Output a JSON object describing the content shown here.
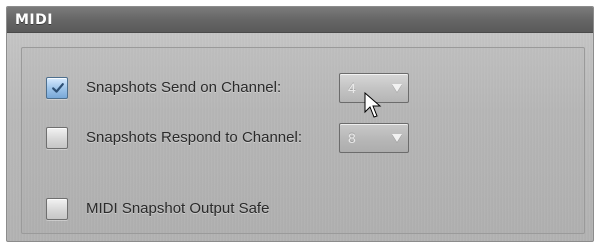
{
  "panel": {
    "title": "MIDI"
  },
  "rows": [
    {
      "checkbox_checked": true,
      "label": "Snapshots Send on Channel:",
      "select_value": "4"
    },
    {
      "checkbox_checked": false,
      "label": "Snapshots Respond to Channel:",
      "select_value": "8"
    },
    {
      "checkbox_checked": false,
      "label": "MIDI Snapshot Output Safe"
    }
  ],
  "icons": {
    "checkmark": "checkmark-icon",
    "dropdown": "chevron-down-icon",
    "cursor": "mouse-pointer-icon"
  },
  "colors": {
    "header_bg": "#666666",
    "panel_bg": "#bdbdbd",
    "checked_blue": "#78a8d8",
    "text_dark": "#2b2b2b"
  }
}
